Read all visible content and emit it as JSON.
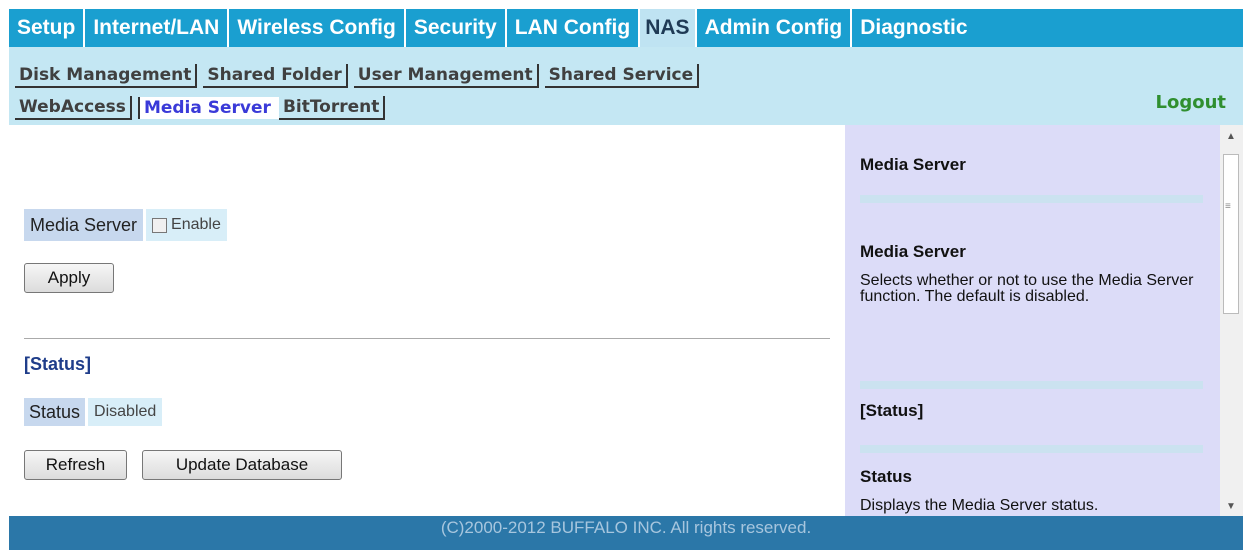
{
  "top_tabs": [
    "Setup",
    "Internet/LAN",
    "Wireless Config",
    "Security",
    "LAN Config",
    "NAS",
    "Admin Config",
    "Diagnostic"
  ],
  "sub_tabs_row1": [
    "Disk Management",
    "Shared Folder",
    "User Management",
    "Shared Service"
  ],
  "sub_tabs_row2": [
    "WebAccess",
    "Media Server",
    "BitTorrent"
  ],
  "logout": "Logout",
  "main": {
    "media_server_label": "Media Server",
    "enable_label": "Enable",
    "apply_button": "Apply",
    "status_heading": "[Status]",
    "status_label": "Status",
    "status_value": "Disabled",
    "refresh_button": "Refresh",
    "update_db_button": "Update Database"
  },
  "help": {
    "title": "Media Server",
    "item1_heading": "Media Server",
    "item1_text": "Selects whether or not to use the Media Server function. The default is disabled.",
    "section_heading": "[Status]",
    "item2_heading": "Status",
    "item2_text": "Displays the Media Server status."
  },
  "footer": "(C)2000-2012 BUFFALO INC. All rights reserved."
}
